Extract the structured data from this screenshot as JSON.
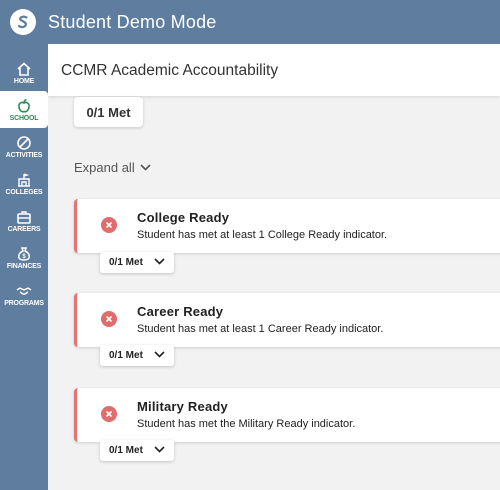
{
  "app": {
    "title": "Student Demo Mode"
  },
  "sidebar": {
    "items": [
      {
        "label": "HOME",
        "icon": "home-icon"
      },
      {
        "label": "SCHOOL",
        "icon": "apple-icon",
        "active": true
      },
      {
        "label": "ACTIVITIES",
        "icon": "activities-icon"
      },
      {
        "label": "COLLEGES",
        "icon": "colleges-icon"
      },
      {
        "label": "CAREERS",
        "icon": "briefcase-icon"
      },
      {
        "label": "FINANCES",
        "icon": "money-bag-icon"
      },
      {
        "label": "PROGRAMS",
        "icon": "handshake-icon"
      }
    ]
  },
  "page": {
    "title": "CCMR Academic Accountability",
    "summary_badge": "0/1 Met",
    "expand_all": "Expand all"
  },
  "indicators": [
    {
      "title": "College Ready",
      "description": "Student has met at least 1 College Ready indicator.",
      "met": "0/1 Met",
      "status": "not-met"
    },
    {
      "title": "Career Ready",
      "description": "Student has met at least 1 Career Ready indicator.",
      "met": "0/1 Met",
      "status": "not-met"
    },
    {
      "title": "Military Ready",
      "description": "Student has met the Military Ready indicator.",
      "met": "0/1 Met",
      "status": "not-met"
    }
  ],
  "colors": {
    "nav": "#5f7d9f",
    "active": "#2e8b57",
    "error": "#e06c6c"
  }
}
